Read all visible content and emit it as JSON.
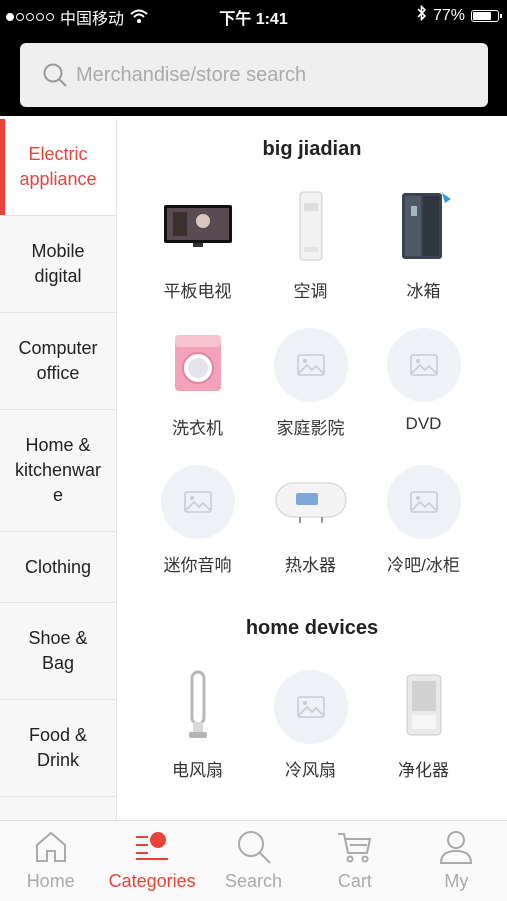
{
  "status_bar": {
    "carrier": "中国移动",
    "time": "下午 1:41",
    "battery": "77%",
    "battery_level": 0.77
  },
  "search": {
    "placeholder": "Merchandise/store search"
  },
  "sidebar": {
    "items": [
      {
        "label": "Electric\nappliance",
        "active": true
      },
      {
        "label": "Mobile\ndigital"
      },
      {
        "label": "Computer\noffice"
      },
      {
        "label": "Home &\nkitchenwar\ne"
      },
      {
        "label": "Clothing"
      },
      {
        "label": "Shoe &\nBag"
      },
      {
        "label": "Food &\nDrink"
      }
    ]
  },
  "sections": [
    {
      "title": "big jiadian",
      "items": [
        {
          "label": "平板电视",
          "icon": "tv-icon"
        },
        {
          "label": "空调",
          "icon": "air-conditioner-icon"
        },
        {
          "label": "冰箱",
          "icon": "refrigerator-icon"
        },
        {
          "label": "洗衣机",
          "icon": "washing-machine-icon"
        },
        {
          "label": "家庭影院",
          "icon": "image-placeholder-icon"
        },
        {
          "label": "DVD",
          "icon": "image-placeholder-icon"
        },
        {
          "label": "迷你音响",
          "icon": "image-placeholder-icon"
        },
        {
          "label": "热水器",
          "icon": "water-heater-icon"
        },
        {
          "label": "冷吧/冰柜",
          "icon": "image-placeholder-icon"
        }
      ]
    },
    {
      "title": "home devices",
      "items": [
        {
          "label": "电风扇",
          "icon": "bladeless-fan-icon"
        },
        {
          "label": "冷风扇",
          "icon": "image-placeholder-icon"
        },
        {
          "label": "净化器",
          "icon": "air-purifier-icon"
        }
      ]
    }
  ],
  "tabbar": {
    "tabs": [
      {
        "label": "Home",
        "icon": "home-icon"
      },
      {
        "label": "Categories",
        "icon": "categories-icon",
        "active": true
      },
      {
        "label": "Search",
        "icon": "search-icon"
      },
      {
        "label": "Cart",
        "icon": "cart-icon"
      },
      {
        "label": "My",
        "icon": "user-icon"
      }
    ]
  },
  "colors": {
    "accent": "#e8443a",
    "header_bg": "#000000",
    "sidebar_bg": "#f7f7f7"
  }
}
